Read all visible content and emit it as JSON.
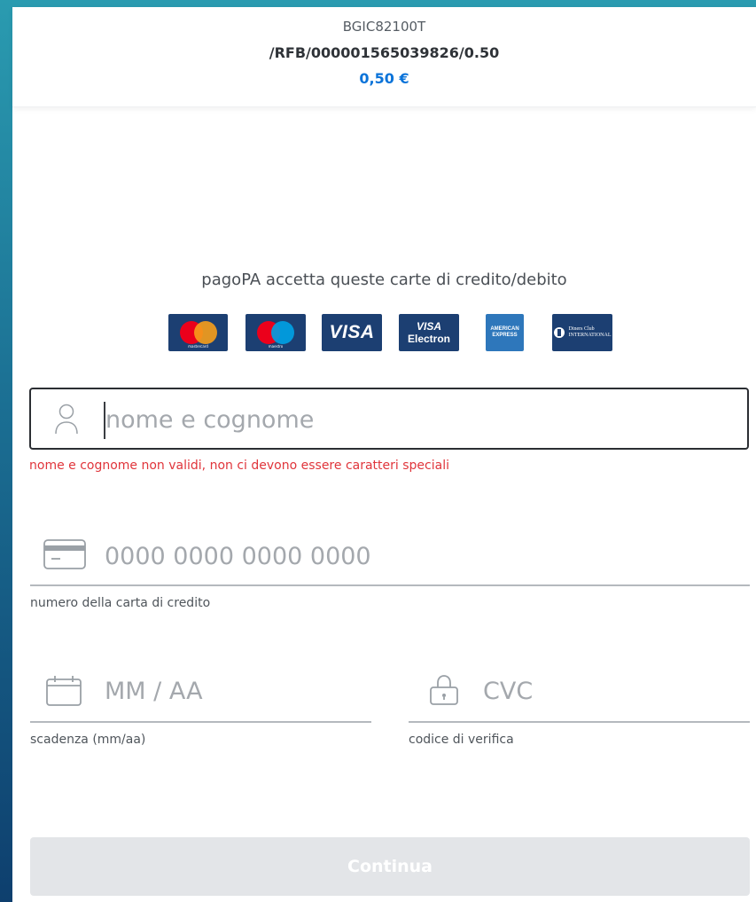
{
  "header": {
    "code": "BGIC82100T",
    "reference": "/RFB/000001565039826/0.50",
    "amount": "0,50 €"
  },
  "cards": {
    "title": "pagoPA accetta queste carte di credito/debito",
    "logos": [
      {
        "name": "mastercard",
        "text": "mastercard"
      },
      {
        "name": "maestro",
        "text": "maestro"
      },
      {
        "name": "visa",
        "text": "VISA"
      },
      {
        "name": "visa-electron",
        "text_top": "VISA",
        "text_bottom": "Electron"
      },
      {
        "name": "american-express",
        "text_top": "AMERICAN",
        "text_bottom": "EXPRESS"
      },
      {
        "name": "diners-club",
        "text_top": "Diners Club",
        "text_bottom": "INTERNATIONAL"
      }
    ]
  },
  "form": {
    "name": {
      "placeholder": "nome e cognome",
      "value": "",
      "error": "nome e cognome non validi, non ci devono essere caratteri speciali",
      "icon": "user-icon"
    },
    "card_number": {
      "placeholder": "0000 0000 0000 0000",
      "value": "",
      "helper": "numero della carta di credito",
      "icon": "credit-card-icon"
    },
    "expiry": {
      "placeholder": "MM / AA",
      "value": "",
      "helper": "scadenza (mm/aa)",
      "icon": "calendar-icon"
    },
    "cvc": {
      "placeholder": "CVC",
      "value": "",
      "helper": "codice di verifica",
      "icon": "lock-icon"
    }
  },
  "continue_label": "Continua",
  "colors": {
    "accent": "#0a73d9",
    "error": "#e0353b",
    "card_logo_bg": "#1c3f72",
    "button_disabled": "#e3e5e8"
  }
}
